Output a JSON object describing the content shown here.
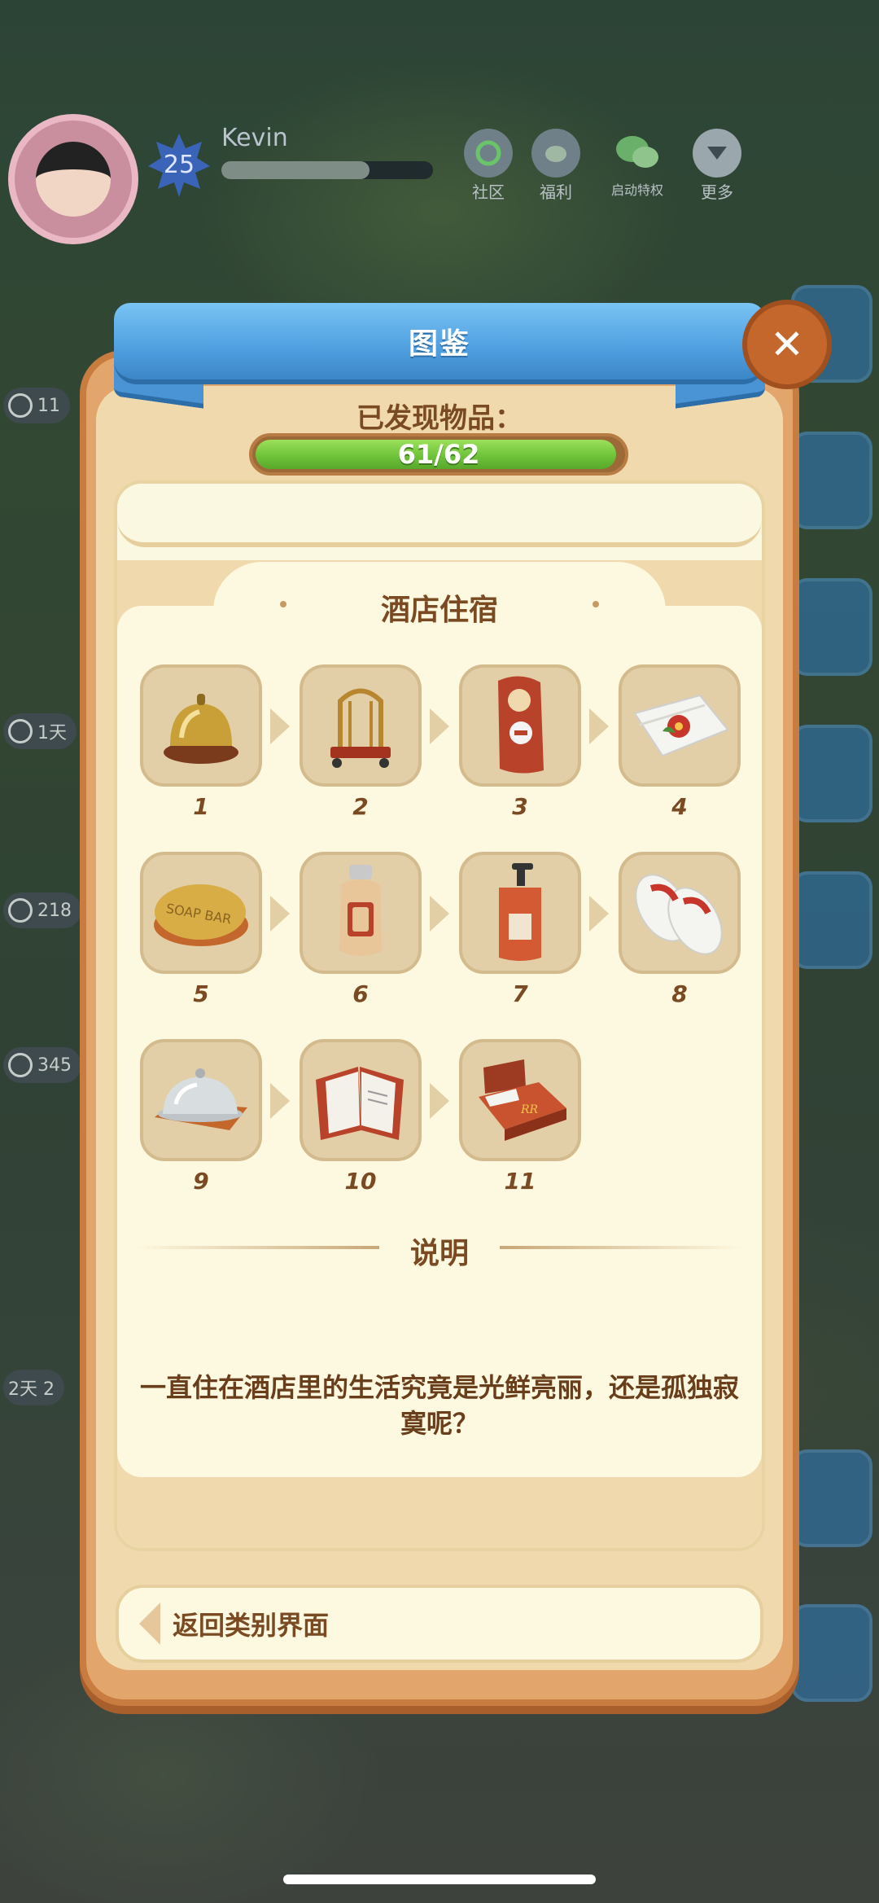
{
  "hud": {
    "player_name": "Kevin",
    "level": "25",
    "xp_progress": 0.7,
    "buttons": [
      {
        "label": "社区",
        "icon": "community-icon"
      },
      {
        "label": "福利",
        "icon": "welfare-icon"
      },
      {
        "label": "启动特权",
        "icon": "wechat-icon"
      },
      {
        "label": "更多",
        "icon": "more-icon"
      }
    ],
    "side_timers": [
      "11",
      "1天",
      "218",
      "345"
    ],
    "bottom_timer": "2天 2"
  },
  "modal": {
    "title": "图鉴",
    "found_label": "已发现物品：",
    "found_count": 61,
    "total_count": 62,
    "progress_text": "61/62",
    "category_title": "酒店住宿",
    "items": [
      {
        "num": "1",
        "icon": "service-bell-icon"
      },
      {
        "num": "2",
        "icon": "luggage-cart-icon"
      },
      {
        "num": "3",
        "icon": "door-hanger-icon"
      },
      {
        "num": "4",
        "icon": "towel-flower-icon"
      },
      {
        "num": "5",
        "icon": "soap-bar-icon"
      },
      {
        "num": "6",
        "icon": "lotion-bottle-icon"
      },
      {
        "num": "7",
        "icon": "pump-bottle-icon"
      },
      {
        "num": "8",
        "icon": "slippers-icon"
      },
      {
        "num": "9",
        "icon": "cloche-icon"
      },
      {
        "num": "10",
        "icon": "guest-book-icon"
      },
      {
        "num": "11",
        "icon": "hotel-bed-icon"
      }
    ],
    "soap_text": "SOAP BAR",
    "bed_text": "RR",
    "description_title": "说明",
    "description": "一直住在酒店里的生活究竟是光鲜亮丽，还是孤独寂寞呢？",
    "back_label": "返回类别界面"
  },
  "colors": {
    "title_blue": "#4f9fe0",
    "progress_green": "#6fc43a",
    "text_brown": "#7a4a22",
    "card_cream": "#fdf9e0",
    "close_orange": "#c4672c"
  }
}
